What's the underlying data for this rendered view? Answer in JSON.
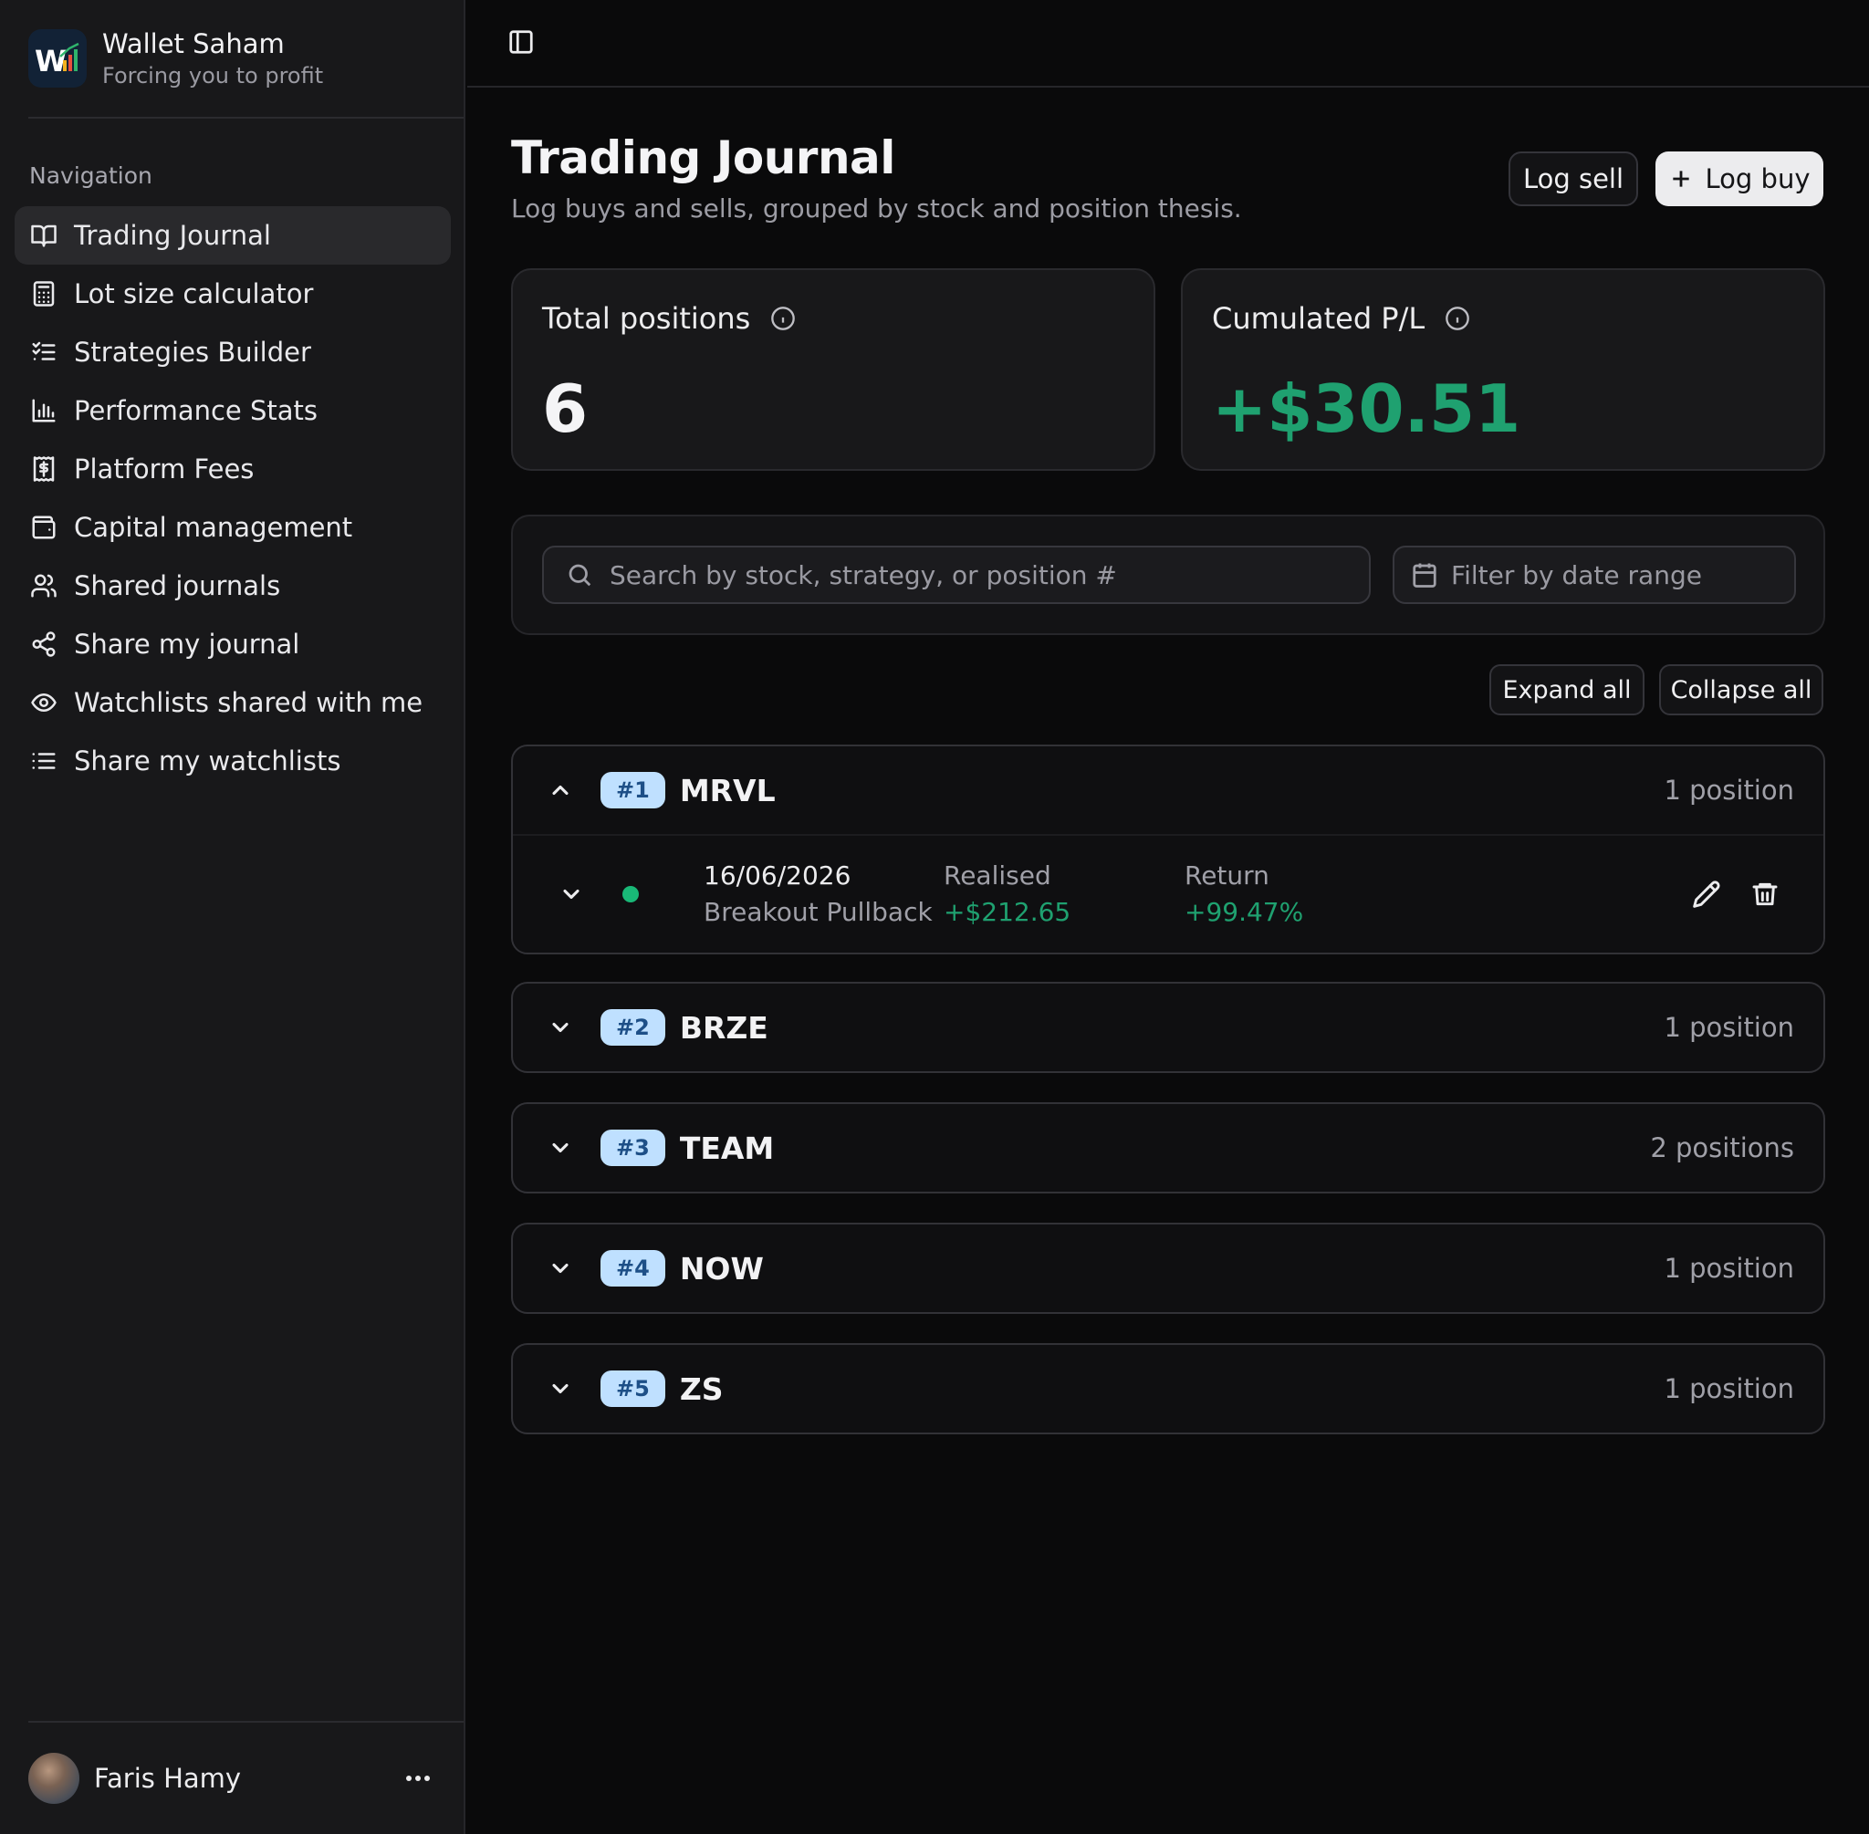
{
  "app": {
    "name": "Wallet Saham",
    "tagline": "Forcing you to profit",
    "logo_text": "W",
    "logo_colors": {
      "background": "#122236",
      "letter": "#ffffff",
      "bars": [
        "#f2b01e",
        "#e94f3c",
        "#2fb46c"
      ]
    }
  },
  "sidebar": {
    "heading": "Navigation",
    "items": [
      {
        "label": "Trading Journal",
        "icon": "book-open-icon",
        "active": true
      },
      {
        "label": "Lot size calculator",
        "icon": "calculator-icon",
        "active": false
      },
      {
        "label": "Strategies Builder",
        "icon": "list-checks-icon",
        "active": false
      },
      {
        "label": "Performance Stats",
        "icon": "bar-chart-icon",
        "active": false
      },
      {
        "label": "Platform Fees",
        "icon": "receipt-dollar-icon",
        "active": false
      },
      {
        "label": "Capital management",
        "icon": "wallet-icon",
        "active": false
      },
      {
        "label": "Shared journals",
        "icon": "users-icon",
        "active": false
      },
      {
        "label": "Share my journal",
        "icon": "share-icon",
        "active": false
      },
      {
        "label": "Watchlists shared with me",
        "icon": "eye-icon",
        "active": false
      },
      {
        "label": "Share my watchlists",
        "icon": "list-icon",
        "active": false
      }
    ],
    "user": {
      "name": "Faris Hamy",
      "menu_icon": "more-horizontal-icon"
    }
  },
  "header": {
    "toggle_icon": "sidebar-toggle-icon"
  },
  "page": {
    "title": "Trading Journal",
    "subtitle": "Log buys and sells, grouped by stock and position thesis.",
    "actions": {
      "sell_label": "Log sell",
      "buy_label": "Log buy"
    }
  },
  "stats": {
    "total_positions": {
      "label": "Total positions",
      "value": "6"
    },
    "cumulated_pl": {
      "label": "Cumulated P/L",
      "value": "+$30.51",
      "color": "#1fa170"
    }
  },
  "filters": {
    "search_placeholder": "Search by stock, strategy, or position #",
    "search_value": "",
    "date_placeholder": "Filter by date range"
  },
  "list_controls": {
    "expand_label": "Expand all",
    "collapse_label": "Collapse all"
  },
  "groups": [
    {
      "badge": "#1",
      "ticker": "MRVL",
      "count": "1 position",
      "expanded": true,
      "positions": [
        {
          "date": "16/06/2026",
          "strategy": "Breakout Pullback",
          "realised_label": "Realised",
          "realised_value": "+$212.65",
          "return_label": "Return",
          "return_value": "+99.47%",
          "status": "closed-win"
        }
      ]
    },
    {
      "badge": "#2",
      "ticker": "BRZE",
      "count": "1 position",
      "expanded": false
    },
    {
      "badge": "#3",
      "ticker": "TEAM",
      "count": "2 positions",
      "expanded": false
    },
    {
      "badge": "#4",
      "ticker": "NOW",
      "count": "1 position",
      "expanded": false
    },
    {
      "badge": "#5",
      "ticker": "ZS",
      "count": "1 position",
      "expanded": false
    }
  ],
  "colors": {
    "accent_positive": "#1fa170",
    "badge_bg": "#bfe0ff",
    "badge_text": "#1d4f87",
    "status_dot": "#19b877"
  }
}
